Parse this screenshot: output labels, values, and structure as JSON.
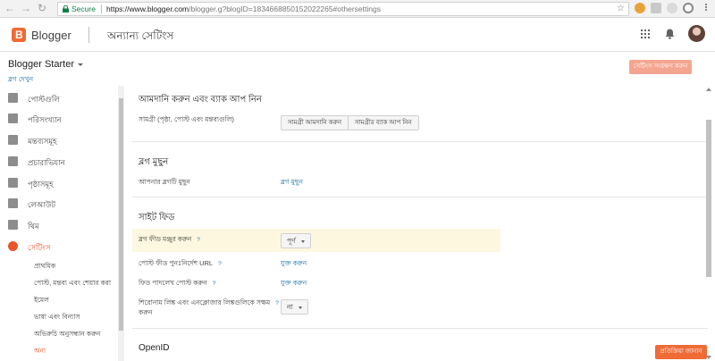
{
  "browser": {
    "secure_label": "Secure",
    "url_main": "https://www.blogger.com",
    "url_rest": "/blogger.g?blogID=1834668850152022265#othersettings"
  },
  "header": {
    "brand": "Blogger",
    "page_title": "অন্যান্য সেটিংস"
  },
  "blog": {
    "name": "Blogger Starter",
    "view_link": "ব্লগ দেখুন",
    "save_button": "সেটিংস সংরক্ষণ করুন"
  },
  "sidebar": {
    "items": [
      {
        "label": "পোস্টগুলি",
        "icon": "posts-icon"
      },
      {
        "label": "পরিসংখ্যান",
        "icon": "stats-icon"
      },
      {
        "label": "মন্তব্যসমূহ",
        "icon": "comments-icon"
      },
      {
        "label": "প্রচারাভিযান",
        "icon": "campaigns-icon"
      },
      {
        "label": "পৃষ্ঠাসমূহ",
        "icon": "pages-icon"
      },
      {
        "label": "লেআউট",
        "icon": "layout-icon"
      },
      {
        "label": "থিম",
        "icon": "theme-icon"
      },
      {
        "label": "সেটিংস",
        "icon": "settings-icon"
      }
    ],
    "sub_items": [
      "প্রাথমিক",
      "পোস্ট, মন্তব্য এবং শেয়ার করা",
      "ইমেল",
      "ভাষা এবং বিন্যাস",
      "অভিরুচি অনুসন্ধান করুন",
      "অন্য"
    ]
  },
  "main": {
    "import_section": {
      "title": "আমদানি করুন এবং ব্যাক আপ নিন",
      "content_label": "সামগ্রী (পৃষ্ঠা, পোস্ট এবং মন্তব্যগুলি)",
      "import_button": "সামগ্রী আমদানি করুন",
      "backup_button": "সামগ্রীর ব্যাক আপ নিন"
    },
    "delete_section": {
      "title": "ব্লগ মুছুন",
      "label": "আপনার ব্লগটি মুছুন",
      "link": "ব্লগ মুছুন"
    },
    "feed_section": {
      "title": "সাইট ফিড",
      "allow_feed_label": "ব্লগ ফীড মঞ্জুর করুন",
      "allow_feed_value": "পূর্ণ",
      "redirect_label": "পোস্ট ফীড পুনঃনির্দেশ URL",
      "redirect_link": "যুক্ত করুন",
      "footer_label": "ফিড পাদলেখ পোস্ট করুন",
      "footer_link": "যুক্ত করুন",
      "enclosure_label_1": "শিরোনাম লিঙ্ক এবং এনক্লোজার লিঙ্কগুলিকে সক্ষম",
      "enclosure_label_2": "করুন",
      "enclosure_value": "না",
      "help": "?"
    },
    "openid_section": {
      "title": "OpenID"
    }
  },
  "feedback_button": "প্রতিক্রিয়া জানান",
  "colors": {
    "accent": "#e8562b",
    "brand": "#f06a35",
    "link": "#1a73a8",
    "highlight": "#fef7e0"
  }
}
